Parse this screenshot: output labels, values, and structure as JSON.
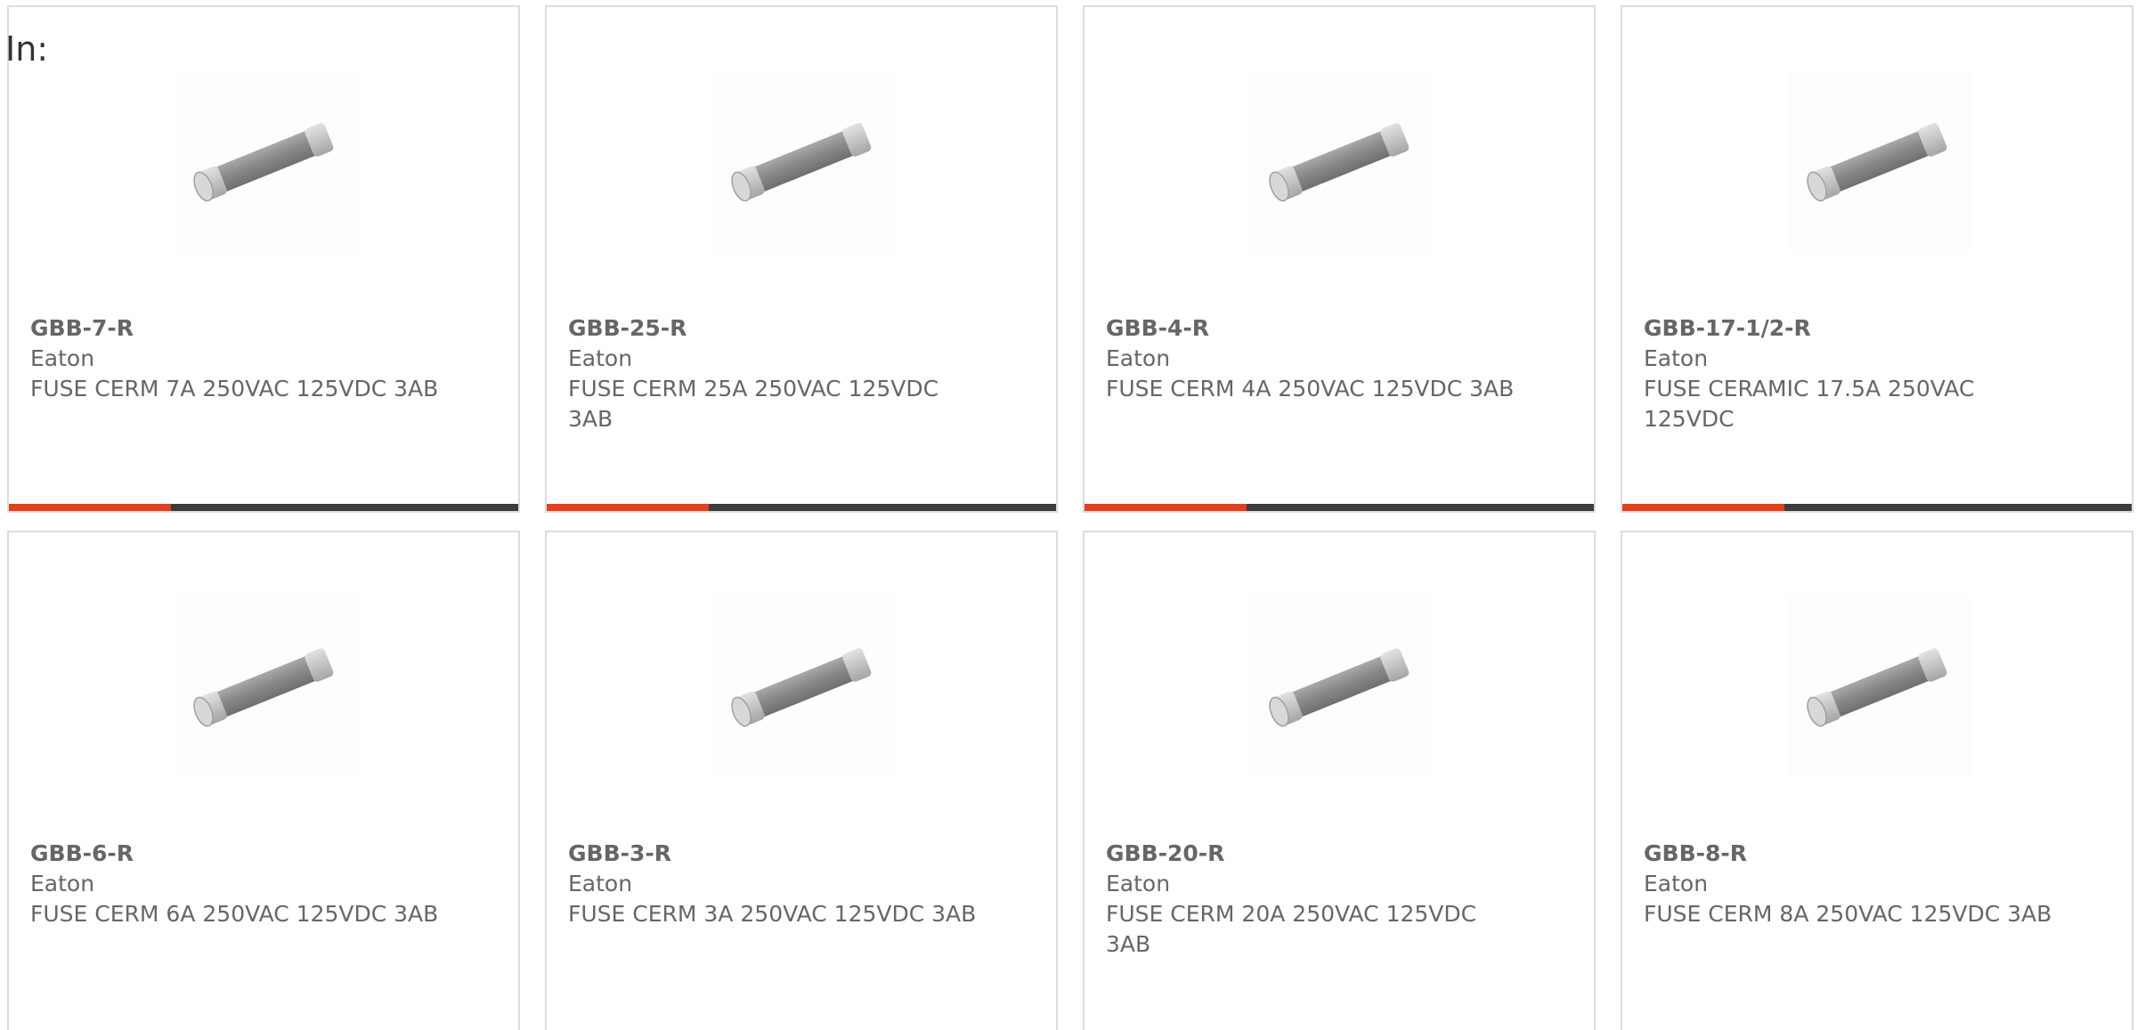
{
  "filter": {
    "label": "In:"
  },
  "brand_colors": {
    "accent": "#e2401c",
    "bar": "#3c3c3c",
    "text": "#666666",
    "border": "#dcdcdc"
  },
  "products": [
    {
      "part_number": "GBB-7-R",
      "manufacturer": "Eaton",
      "description": "FUSE CERM 7A 250VAC 125VDC 3AB",
      "image": "fuse-icon"
    },
    {
      "part_number": "GBB-25-R",
      "manufacturer": "Eaton",
      "description": "FUSE CERM 25A 250VAC 125VDC 3AB",
      "image": "fuse-icon"
    },
    {
      "part_number": "GBB-4-R",
      "manufacturer": "Eaton",
      "description": "FUSE CERM 4A 250VAC 125VDC 3AB",
      "image": "fuse-icon"
    },
    {
      "part_number": "GBB-17-1/2-R",
      "manufacturer": "Eaton",
      "description": "FUSE CERAMIC 17.5A 250VAC 125VDC",
      "image": "fuse-icon"
    },
    {
      "part_number": "GBB-6-R",
      "manufacturer": "Eaton",
      "description": "FUSE CERM 6A 250VAC 125VDC 3AB",
      "image": "fuse-icon"
    },
    {
      "part_number": "GBB-3-R",
      "manufacturer": "Eaton",
      "description": "FUSE CERM 3A 250VAC 125VDC 3AB",
      "image": "fuse-icon"
    },
    {
      "part_number": "GBB-20-R",
      "manufacturer": "Eaton",
      "description": "FUSE CERM 20A 250VAC 125VDC 3AB",
      "image": "fuse-icon"
    },
    {
      "part_number": "GBB-8-R",
      "manufacturer": "Eaton",
      "description": "FUSE CERM 8A 250VAC 125VDC 3AB",
      "image": "fuse-icon"
    }
  ]
}
